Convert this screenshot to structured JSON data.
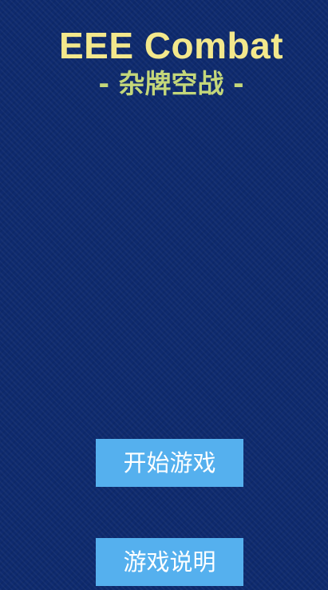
{
  "colors": {
    "background": "#0e2a6e",
    "title": "#f3e88c",
    "subtitle": "#c4d77a",
    "button_bg": "#55b0ee",
    "button_text": "#ffffff"
  },
  "header": {
    "title": "EEE Combat",
    "subtitle": "- 杂牌空战 -"
  },
  "menu": {
    "start_label": "开始游戏",
    "help_label": "游戏说明"
  }
}
